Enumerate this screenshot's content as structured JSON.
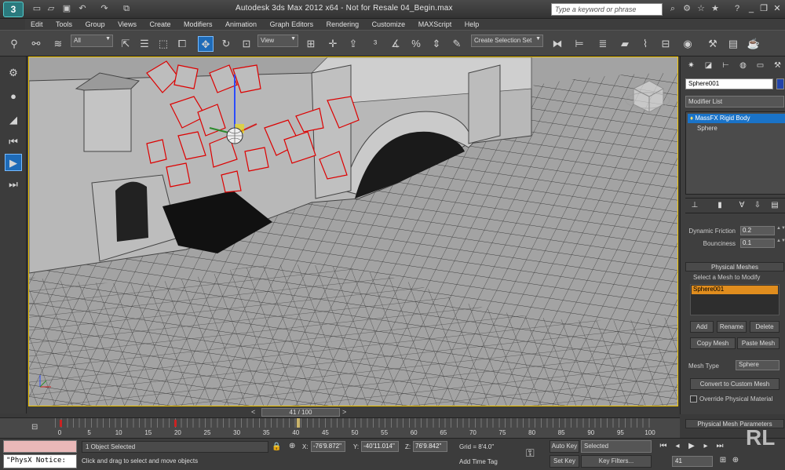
{
  "titlebar": {
    "title": "Autodesk 3ds Max 2012 x64 - Not for Resale    04_Begin.max",
    "search_placeholder": "Type a keyword or phrase",
    "logo": "3"
  },
  "menus": [
    "Edit",
    "Tools",
    "Group",
    "Views",
    "Create",
    "Modifiers",
    "Animation",
    "Graph Editors",
    "Rendering",
    "Customize",
    "MAXScript",
    "Help"
  ],
  "toolbar": {
    "filter": "All",
    "ref_coord": "View",
    "selection_set": "Create Selection Set"
  },
  "command_panel": {
    "object_name": "Sphere001",
    "object_color": "#2244aa",
    "modifier_list": "Modifier List",
    "stack": [
      "MassFX Rigid Body",
      "Sphere"
    ],
    "dynamic_friction_label": "Dynamic Friction",
    "dynamic_friction": "0.2",
    "bounciness_label": "Bounciness",
    "bounciness": "0.1",
    "physical_meshes_title": "Physical Meshes",
    "select_mesh_label": "Select a Mesh to Modify",
    "mesh_list": [
      "Sphere001"
    ],
    "add": "Add",
    "rename": "Rename",
    "delete": "Delete",
    "copy_mesh": "Copy Mesh",
    "paste_mesh": "Paste Mesh",
    "mesh_type_label": "Mesh Type",
    "mesh_type": "Sphere",
    "convert": "Convert to Custom Mesh",
    "override": "Override Physical Material",
    "params_title": "Physical Mesh Parameters"
  },
  "timeline": {
    "slider": "41 / 100",
    "current_frame": 41,
    "ticks": [
      "0",
      "5",
      "10",
      "15",
      "20",
      "25",
      "30",
      "35",
      "40",
      "45",
      "50",
      "55",
      "60",
      "65",
      "70",
      "75",
      "80",
      "85",
      "90",
      "95",
      "100"
    ]
  },
  "status": {
    "listener_output": "\"PhysX Notice:",
    "selection": "1 Object Selected",
    "prompt": "Click and drag to select and move objects",
    "x_label": "X:",
    "x": "-76'9.872\"",
    "y_label": "Y:",
    "y": "-40'11.014\"",
    "z_label": "Z:",
    "z": "76'9.842\"",
    "grid": "Grid = 8'4.0\"",
    "add_time_tag": "Add Time Tag",
    "auto_key": "Auto Key",
    "set_key": "Set Key",
    "selected": "Selected",
    "key_filters": "Key Filters...",
    "frame": "41"
  }
}
